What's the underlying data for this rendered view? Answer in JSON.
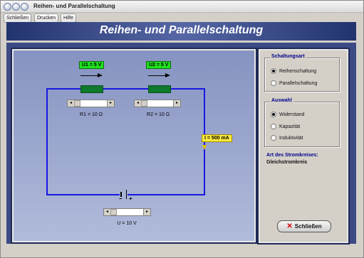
{
  "window": {
    "title": "Reihen- und Parallelschaltung"
  },
  "menu": {
    "items": [
      "Schließen",
      "Drucken",
      "Hilfe"
    ]
  },
  "banner": {
    "title": "Reihen- und Parallelschaltung"
  },
  "circuit": {
    "u1_label": "U1 = 5 V",
    "u2_label": "U2 = 5 V",
    "r1_label": "R1 = 10 Ω",
    "r2_label": "R2 = 10 Ω",
    "current_label": "I = 500 mA",
    "voltage_label": "U = 10 V",
    "battery_minus": "−",
    "battery_plus": "+",
    "sliders": {
      "r1": 0.1,
      "r2": 0.1,
      "u": 0.1
    }
  },
  "schaltungsart": {
    "title": "Schaltungsart",
    "options": [
      "Reihenschaltung",
      "Parallelschaltung"
    ],
    "selected": "Reihenschaltung"
  },
  "auswahl": {
    "title": "Auswahl",
    "options": [
      "Widerstand",
      "Kapazität",
      "Induktivität"
    ],
    "selected": "Widerstand"
  },
  "info": {
    "label": "Art des Stromkreises:",
    "value": "Gleichstromkreis"
  },
  "close_button": {
    "label": "Schließen"
  },
  "colors": {
    "wire": "#1818e0",
    "resistor": "#0f7a2b",
    "voltage_label": "#1fe01f",
    "current_label": "#ffeb3b",
    "banner": "#22336e"
  }
}
